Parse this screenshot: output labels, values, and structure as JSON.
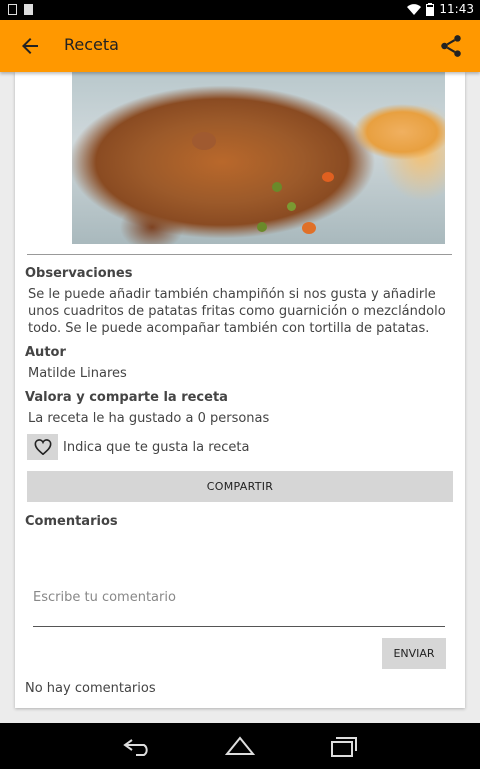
{
  "statusbar": {
    "time": "11:43"
  },
  "appbar": {
    "title": "Receta"
  },
  "recipe": {
    "observations_label": "Observaciones",
    "observations_text": "Se le puede añadir también champiñón si nos gusta y añadirle unos cuadritos de patatas fritas como guarnición o mezclándolo todo. Se le puede acompañar también con tortilla de patatas.",
    "author_label": "Autor",
    "author_name": "Matilde Linares",
    "rate_label": "Valora y comparte la receta",
    "likes_text": "La receta le ha gustado a 0 personas",
    "like_prompt": "Indica que te gusta la receta",
    "share_button": "COMPARTIR"
  },
  "comments": {
    "label": "Comentarios",
    "placeholder": "Escribe tu comentario",
    "send_button": "ENVIAR",
    "empty_text": "No hay comentarios"
  },
  "colors": {
    "appbar": "#ff9800",
    "button_bg": "#d6d6d6"
  },
  "icons": [
    "back-arrow-icon",
    "share-icon",
    "heart-icon",
    "nav-back-icon",
    "nav-home-icon",
    "nav-recents-icon"
  ]
}
